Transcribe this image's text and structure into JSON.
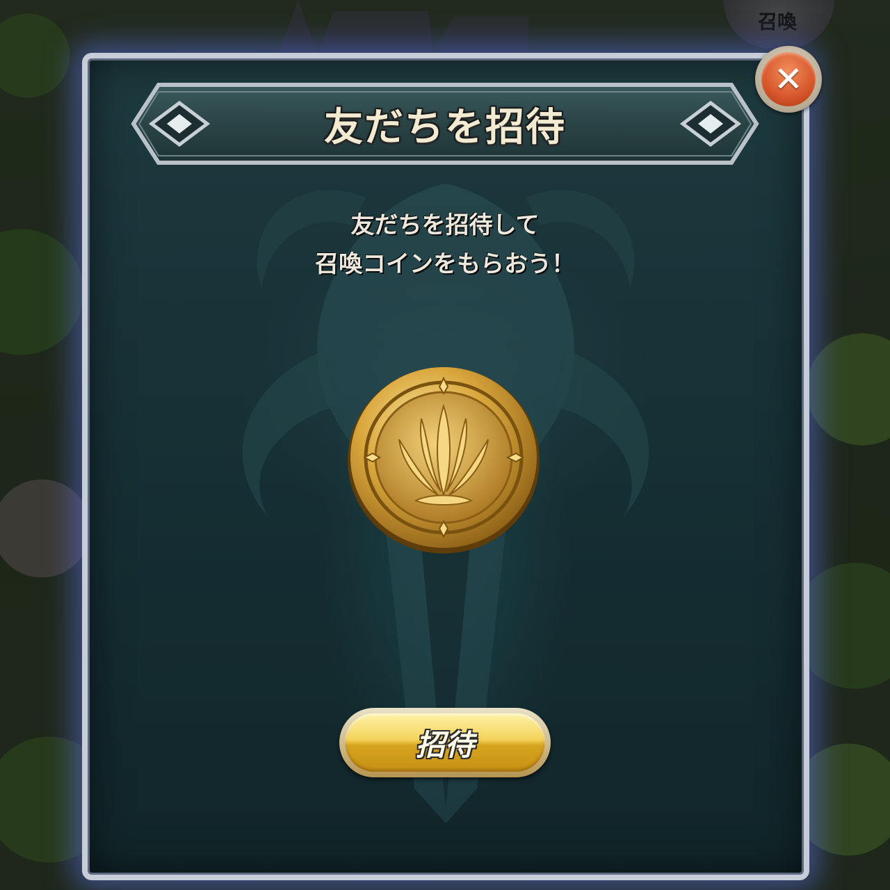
{
  "background": {
    "summon_label": "召喚"
  },
  "dialog": {
    "title": "友だちを招待",
    "description_line1": "友だちを招待して",
    "description_line2": "召喚コインをもらおう！",
    "reward_icon": "summon-coin-icon",
    "invite_label": "招待",
    "close_icon": "close-icon",
    "close_glyph": "✕"
  },
  "colors": {
    "panel": "#163035",
    "border": "#c6cdd8",
    "glow": "#5a6edc",
    "gold": "#f4d35a",
    "close": "#d6552a"
  }
}
